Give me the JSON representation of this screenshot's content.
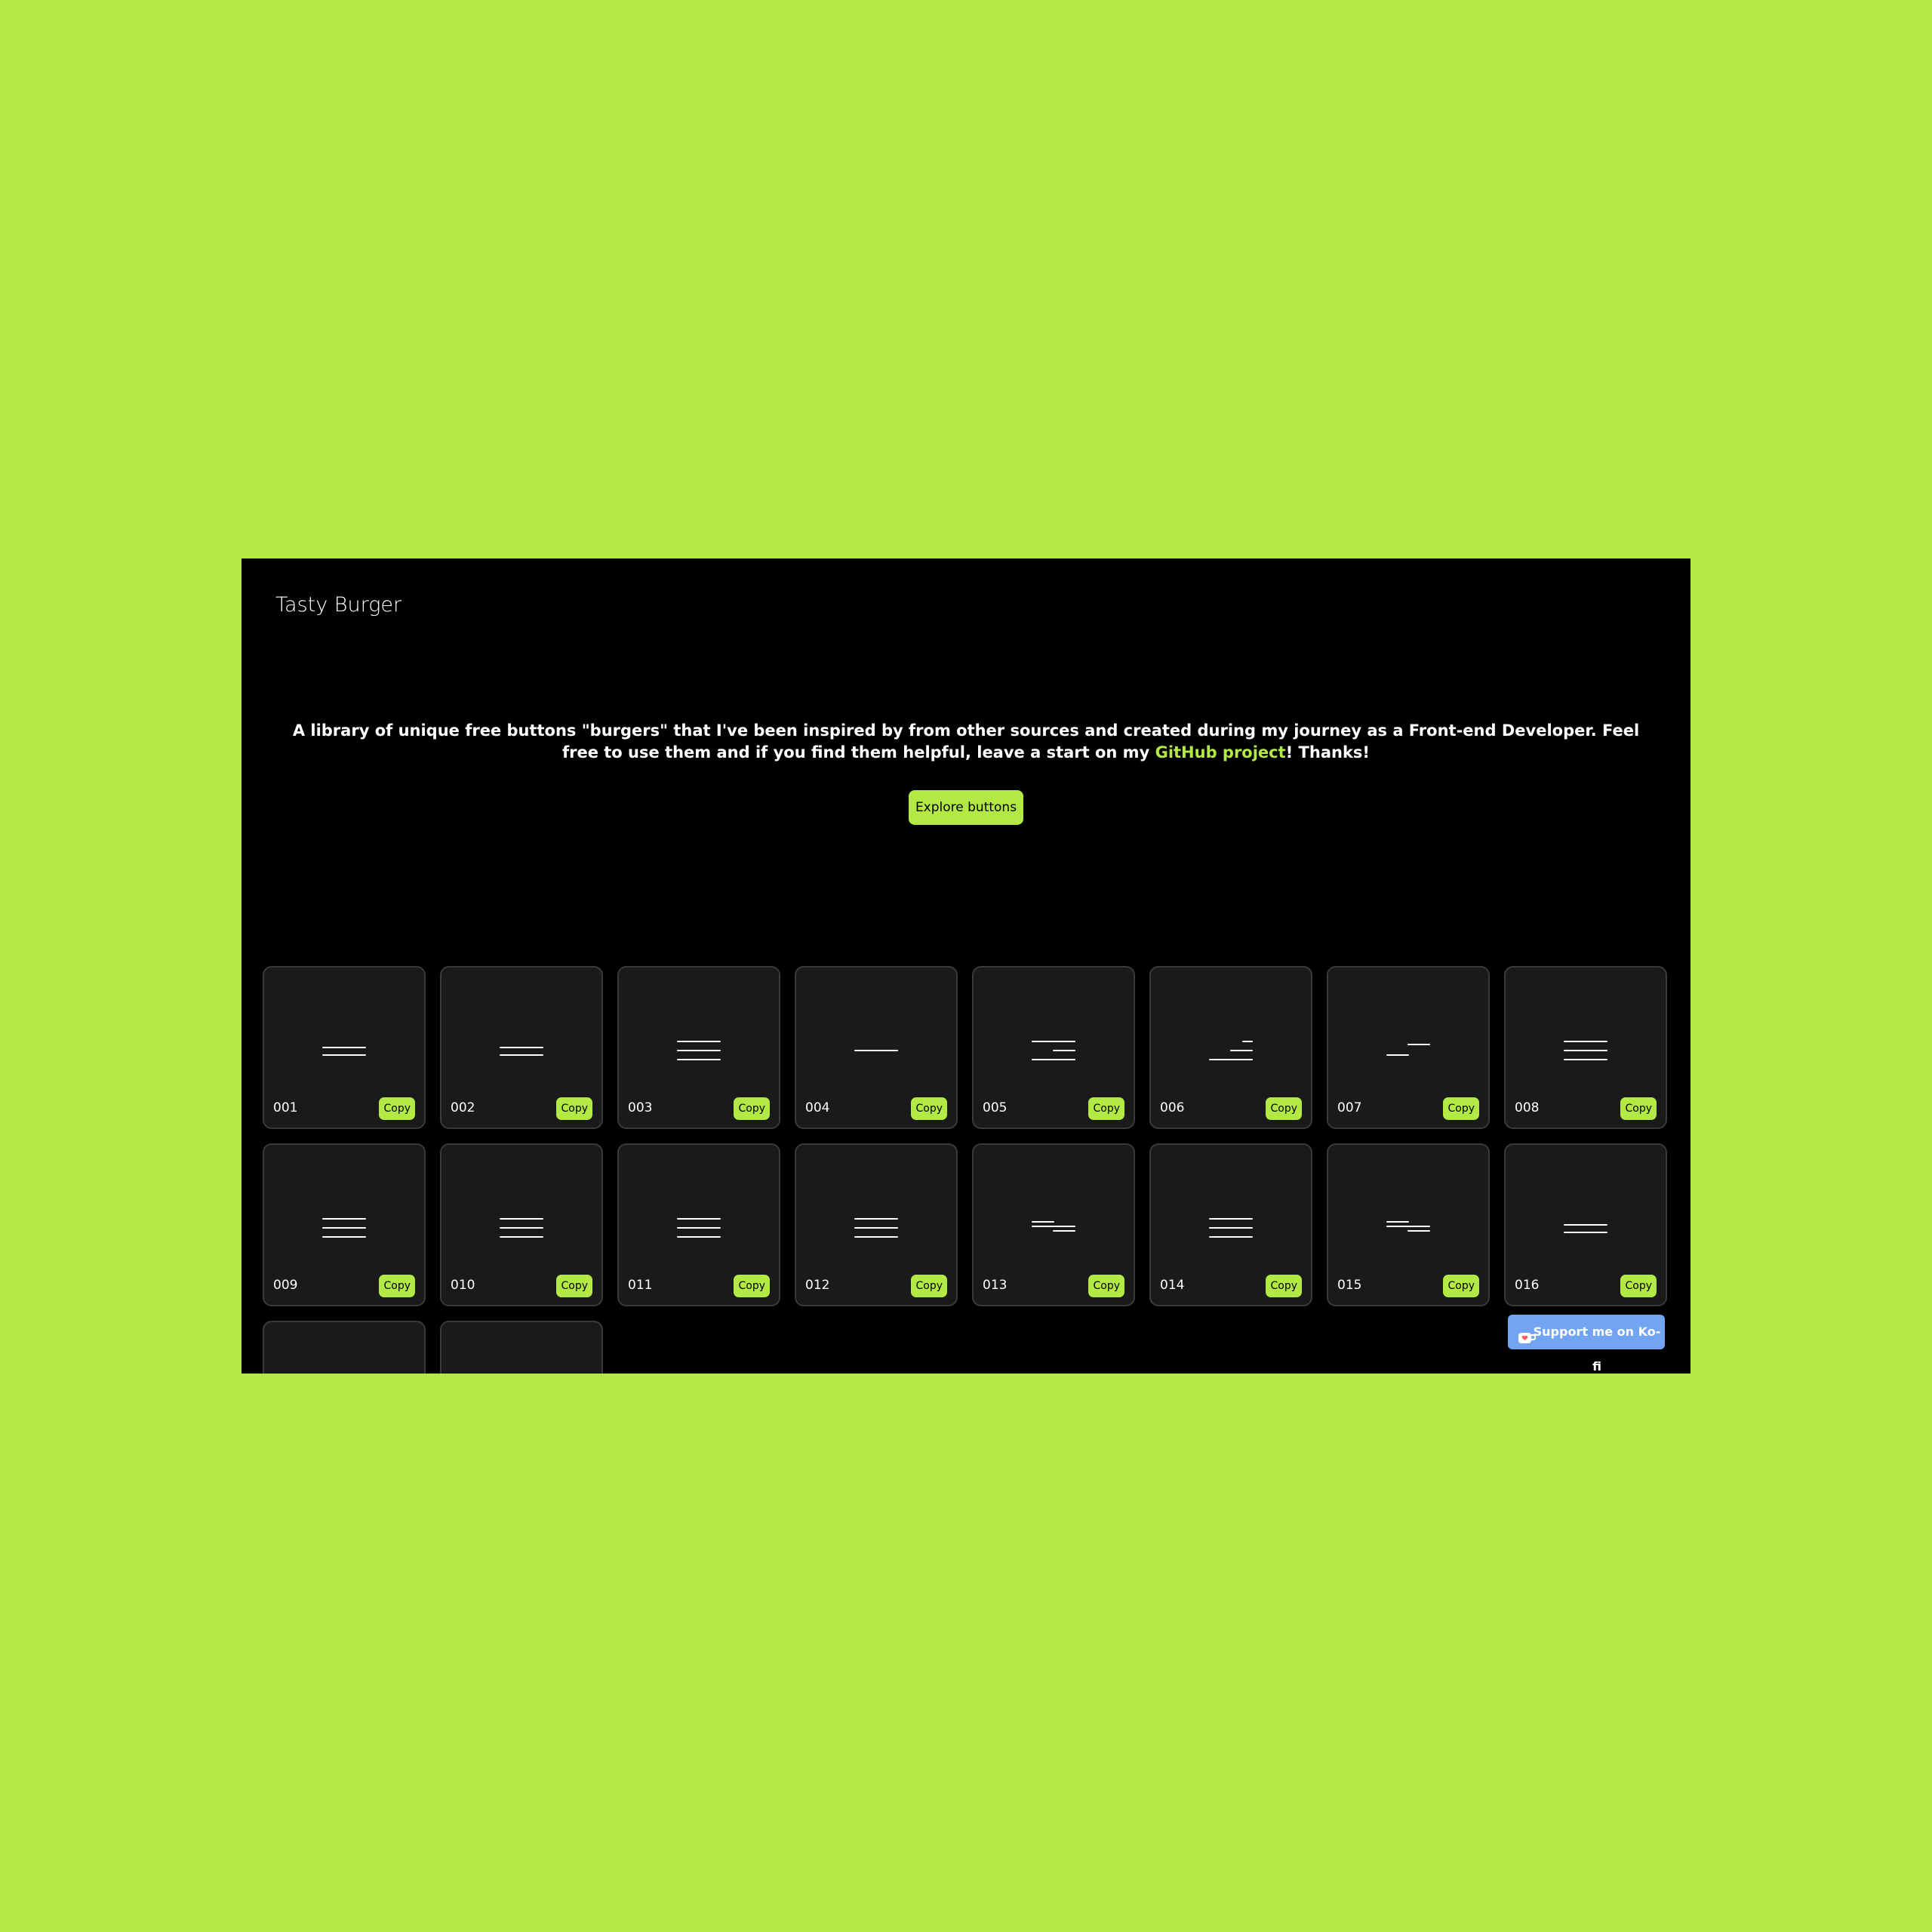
{
  "header": {
    "brand": "Tasty Burger"
  },
  "intro": {
    "text_before": "A library of unique free buttons \"burgers\" that I've been inspired by from other sources and created during my journey as a Front-end Developer. Feel free to use them and if you find them helpful, leave a start on my ",
    "link_text": "GitHub project",
    "text_after": "! Thanks!"
  },
  "explore_label": "Explore buttons",
  "colors": {
    "accent": "#b3e944",
    "background": "#000000",
    "card": "#1a1a1a",
    "card_border": "#3a3a3a",
    "kofi": "#72a4f2"
  },
  "cards": [
    {
      "id": "001",
      "copy": "Copy",
      "icon": "two-line-burger-icon"
    },
    {
      "id": "002",
      "copy": "Copy",
      "icon": "two-line-burger-icon"
    },
    {
      "id": "003",
      "copy": "Copy",
      "icon": "three-line-burger-icon"
    },
    {
      "id": "004",
      "copy": "Copy",
      "icon": "single-line-icon"
    },
    {
      "id": "005",
      "copy": "Copy",
      "icon": "staggered-burger-icon"
    },
    {
      "id": "006",
      "copy": "Copy",
      "icon": "right-steps-burger-icon"
    },
    {
      "id": "007",
      "copy": "Copy",
      "icon": "offset-lines-icon"
    },
    {
      "id": "008",
      "copy": "Copy",
      "icon": "three-line-burger-icon"
    },
    {
      "id": "009",
      "copy": "Copy",
      "icon": "three-line-burger-icon"
    },
    {
      "id": "010",
      "copy": "Copy",
      "icon": "three-line-burger-icon"
    },
    {
      "id": "011",
      "copy": "Copy",
      "icon": "three-line-burger-icon"
    },
    {
      "id": "012",
      "copy": "Copy",
      "icon": "three-line-burger-icon"
    },
    {
      "id": "013",
      "copy": "Copy",
      "icon": "left-cascade-burger-icon"
    },
    {
      "id": "014",
      "copy": "Copy",
      "icon": "three-line-burger-icon"
    },
    {
      "id": "015",
      "copy": "Copy",
      "icon": "left-cascade-burger-icon"
    },
    {
      "id": "016",
      "copy": "Copy",
      "icon": "two-line-burger-icon"
    },
    {
      "id": "",
      "copy": "",
      "icon": ""
    },
    {
      "id": "",
      "copy": "",
      "icon": ""
    }
  ],
  "kofi": {
    "label": "Support me on Ko-fi",
    "icon": "coffee-cup-icon"
  }
}
